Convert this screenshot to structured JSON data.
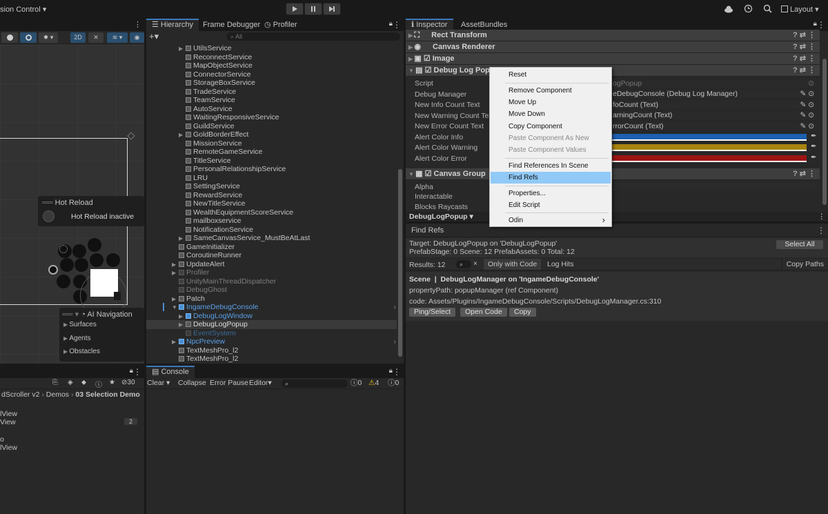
{
  "toolbar": {
    "version_control": "sion Control",
    "version_control_arrow": "▾",
    "layout": "Layout",
    "layout_arrow": "▾"
  },
  "scene": {
    "mode_2d": "2D",
    "hot_reload_title": "Hot Reload",
    "hot_reload_status": "Hot Reload inactive",
    "ai_nav_title": "AI Navigation",
    "ai_nav_items": [
      "Surfaces",
      "Agents",
      "Obstacles"
    ]
  },
  "hierarchy": {
    "tabs": [
      "Hierarchy",
      "Frame Debugger",
      "Profiler"
    ],
    "search_placeholder": "All",
    "items": [
      "UtilsService",
      "ReconnectService",
      "MapObjectService",
      "ConnectorService",
      "StorageBoxService",
      "TradeService",
      "TeamService",
      "AutoService",
      "WaitingResponsiveService",
      "GuildService",
      "GoldBorderEffect",
      "MissionService",
      "RemoteGameService",
      "TitleService",
      "PersonalRelationshipService",
      "LRU",
      "SettingService",
      "RewardService",
      "NewTitleService",
      "WealthEquipmentScoreService",
      "mailboxservice",
      "NotificationService",
      "SameCanvasService_MustBeAtLast",
      "GameInitializer",
      "CoroutineRunner",
      "UpdateAlert",
      "Profiler",
      "UnityMainThreadDispatcher",
      "DebugGhost",
      "Patch",
      "IngameDebugConsole",
      "DebugLogWindow",
      "DebugLogPopup",
      "EventSystem",
      "NpcPreview",
      "TextMeshPro_l2",
      "TextMeshPro_l2"
    ]
  },
  "inspector": {
    "tabs": [
      "Inspector",
      "AssetBundles"
    ],
    "components": [
      "Rect Transform",
      "Canvas Renderer",
      "Image",
      "Debug Log Popup",
      "Canvas Group"
    ],
    "props": {
      "script": "Script",
      "script_val": "ogPopup",
      "debug_manager": "Debug Manager",
      "debug_manager_val": "eDebugConsole (Debug Log Manager)",
      "new_info": "New Info Count Text",
      "new_info_val": "foCount (Text)",
      "new_warning": "New Warning Count Text",
      "new_warning_val": "arningCount (Text)",
      "new_error": "New Error Count Text",
      "new_error_val": "rrorCount (Text)",
      "alert_info": "Alert Color Info",
      "alert_warning": "Alert Color Warning",
      "alert_error": "Alert Color Error",
      "alpha": "Alpha",
      "interactable": "Interactable",
      "blocks_raycasts": "Blocks Raycasts"
    },
    "colors": {
      "info": "#1d5fb0",
      "warning": "#a8840f",
      "error": "#9c1414"
    },
    "footer_object": "DebugLogPopup"
  },
  "context_menu": {
    "items": [
      "Reset",
      "Remove Component",
      "Move Up",
      "Move Down",
      "Copy Component",
      "Paste Component As New",
      "Paste Component Values",
      "Find References In Scene",
      "Find Refs",
      "Properties...",
      "Edit Script",
      "Odin"
    ],
    "submenu_arrow": "›"
  },
  "find_refs": {
    "tab": "Find Refs",
    "target": "Target: DebugLogPopup on 'DebugLogPopup'",
    "counts": "PrefabStage: 0   Scene: 12   PrefabAssets: 0   Total: 12",
    "select_all": "Select All",
    "results": "Results: 12",
    "clear_search": "×",
    "only_with_code": "Only with Code",
    "log_hits": "Log Hits",
    "copy_paths": "Copy Paths",
    "scene_label": "Scene",
    "result_title": "DebugLogManager on 'IngameDebugConsole'",
    "property_path": "propertyPath: popupManager   (ref Component)",
    "code": "code: Assets/Plugins/IngameDebugConsole/Scripts/DebugLogManager.cs:310",
    "ping": "Ping/Select",
    "open_code": "Open Code",
    "copy": "Copy"
  },
  "console": {
    "tab": "Console",
    "clear": "Clear",
    "clear_arrow": "▾",
    "collapse": "Collapse",
    "error_pause": "Error Pause",
    "editor": "Editor",
    "editor_arrow": "▾",
    "log_count": "0",
    "warn_count": "4",
    "err_count": "0"
  },
  "project": {
    "hidden_count": "30",
    "breadcrumb": [
      "dScroller v2",
      "Demos",
      "03 Selection Demo"
    ],
    "items": [
      "lView",
      "View",
      "o",
      "lView"
    ],
    "badge": "2"
  }
}
